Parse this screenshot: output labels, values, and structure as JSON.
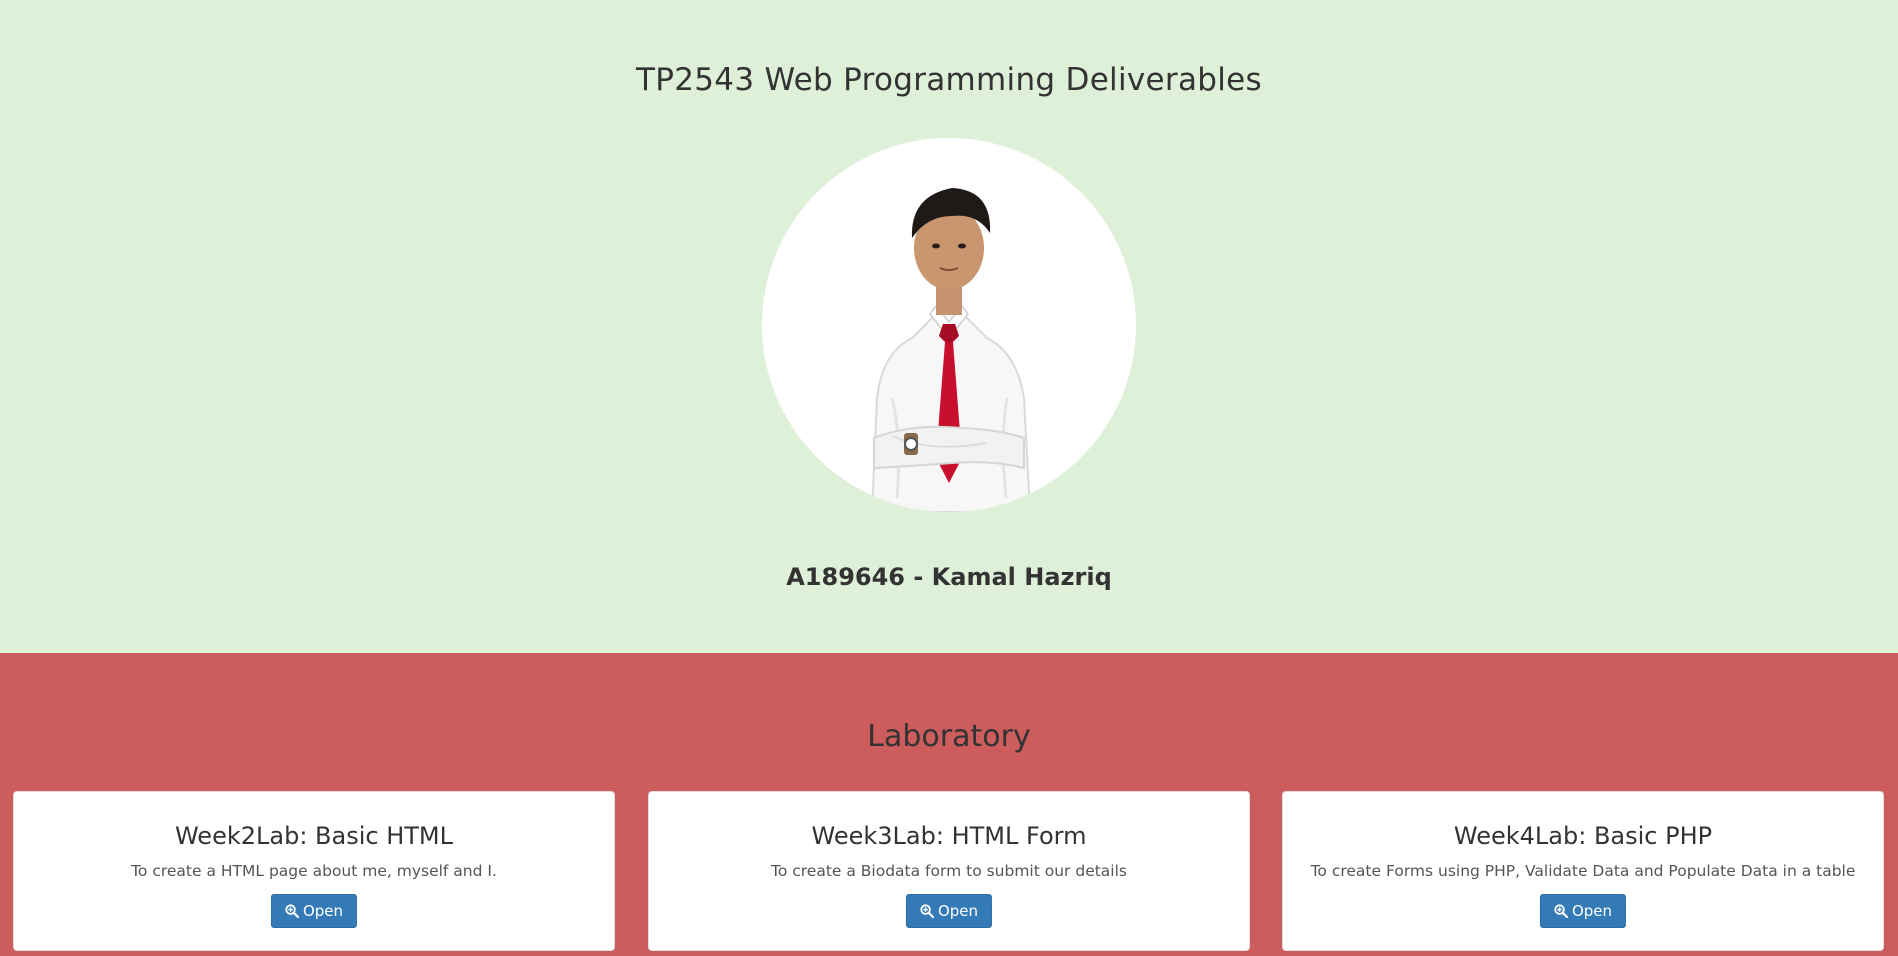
{
  "hero": {
    "title": "TP2543 Web Programming Deliverables",
    "student": "A189646 - Kamal Hazriq",
    "background": "#dff0d8"
  },
  "lab": {
    "title": "Laboratory",
    "background": "#cd5c5c",
    "cards": [
      {
        "title": "Week2Lab: Basic HTML",
        "description": "To create a HTML page about me, myself and I.",
        "button_label": "Open",
        "button_icon": "zoom-in-icon"
      },
      {
        "title": "Week3Lab: HTML Form",
        "description": "To create a Biodata form to submit our details",
        "button_label": "Open",
        "button_icon": "zoom-in-icon"
      },
      {
        "title": "Week4Lab: Basic PHP",
        "description": "To create Forms using PHP, Validate Data and Populate Data in a table",
        "button_label": "Open",
        "button_icon": "zoom-in-icon"
      }
    ]
  },
  "colors": {
    "button": "#337ab7",
    "card": "#ffffff"
  }
}
